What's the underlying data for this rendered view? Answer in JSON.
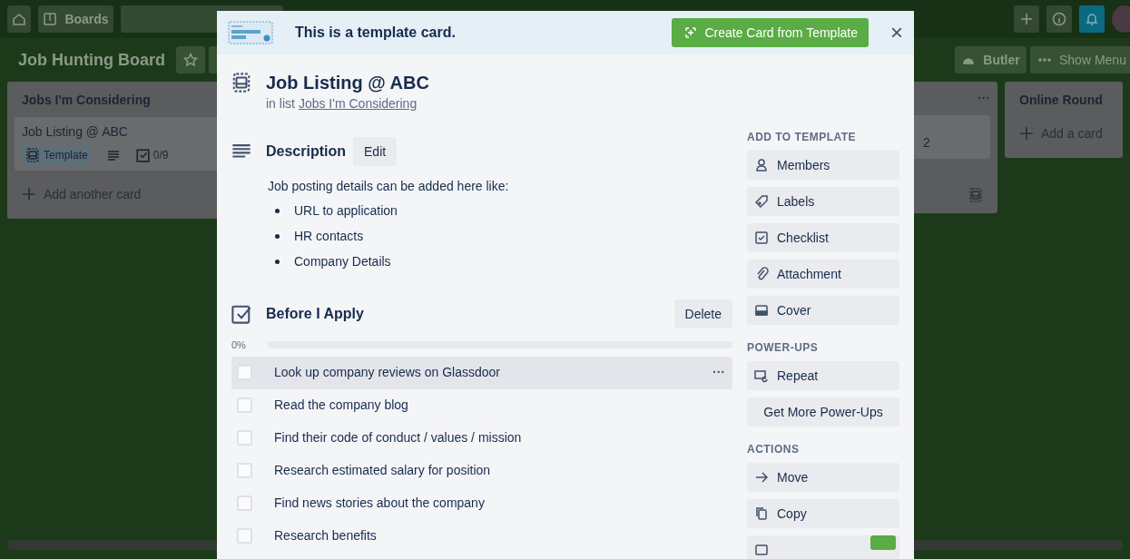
{
  "topbar": {
    "boards_label": "Boards"
  },
  "board": {
    "title": "Job Hunting Board",
    "butler_label": "Butler",
    "menu_label": "Show Menu"
  },
  "lists": [
    {
      "title": "Jobs I'm Considering",
      "cards": [
        {
          "title": "Job Listing @ ABC",
          "template_label": "Template",
          "checklist_count": "0/9"
        }
      ],
      "add_label": "Add another card"
    },
    {
      "menu": "···",
      "card_fragment": "2"
    },
    {
      "title": "Online Round",
      "add_label": "Add a card"
    }
  ],
  "modal": {
    "banner_text": "This is a template card.",
    "create_button": "Create Card from Template",
    "close": "×",
    "title": "Job Listing @ ABC",
    "in_list_prefix": "in list",
    "list_link": "Jobs I'm Considering",
    "description": {
      "heading": "Description",
      "edit_button": "Edit",
      "intro": "Job posting details can be added here like:",
      "bullets": [
        "URL to application",
        "HR contacts",
        "Company Details"
      ]
    },
    "checklist": {
      "heading": "Before I Apply",
      "delete_button": "Delete",
      "percent": "0%",
      "level": 0,
      "items": [
        {
          "text": "Look up company reviews on Glassdoor",
          "checked": false,
          "hovered": true,
          "menu": "···"
        },
        {
          "text": "Read the company blog",
          "checked": false,
          "hovered": false
        },
        {
          "text": "Find their code of conduct / values / mission",
          "checked": false,
          "hovered": false
        },
        {
          "text": "Research estimated salary for position",
          "checked": false,
          "hovered": false
        },
        {
          "text": "Find news stories about the company",
          "checked": false,
          "hovered": false
        },
        {
          "text": "Research benefits",
          "checked": false,
          "hovered": false
        }
      ]
    },
    "sidebar": [
      {
        "heading": "ADD TO TEMPLATE",
        "buttons": [
          {
            "label": "Members",
            "kind": "person"
          },
          {
            "label": "Labels",
            "kind": "tag"
          },
          {
            "label": "Checklist",
            "kind": "check"
          },
          {
            "label": "Attachment",
            "kind": "clip"
          },
          {
            "label": "Cover",
            "kind": "cover"
          }
        ]
      },
      {
        "heading": "POWER-UPS",
        "buttons": [
          {
            "label": "Repeat",
            "kind": "repeat"
          },
          {
            "label": "Get More Power-Ups",
            "kind": "plain"
          }
        ]
      },
      {
        "heading": "ACTIONS",
        "buttons": [
          {
            "label": "Move",
            "kind": "arrow"
          },
          {
            "label": "Copy",
            "kind": "copy"
          },
          {
            "kind": "card",
            "badge": true
          }
        ]
      }
    ]
  }
}
